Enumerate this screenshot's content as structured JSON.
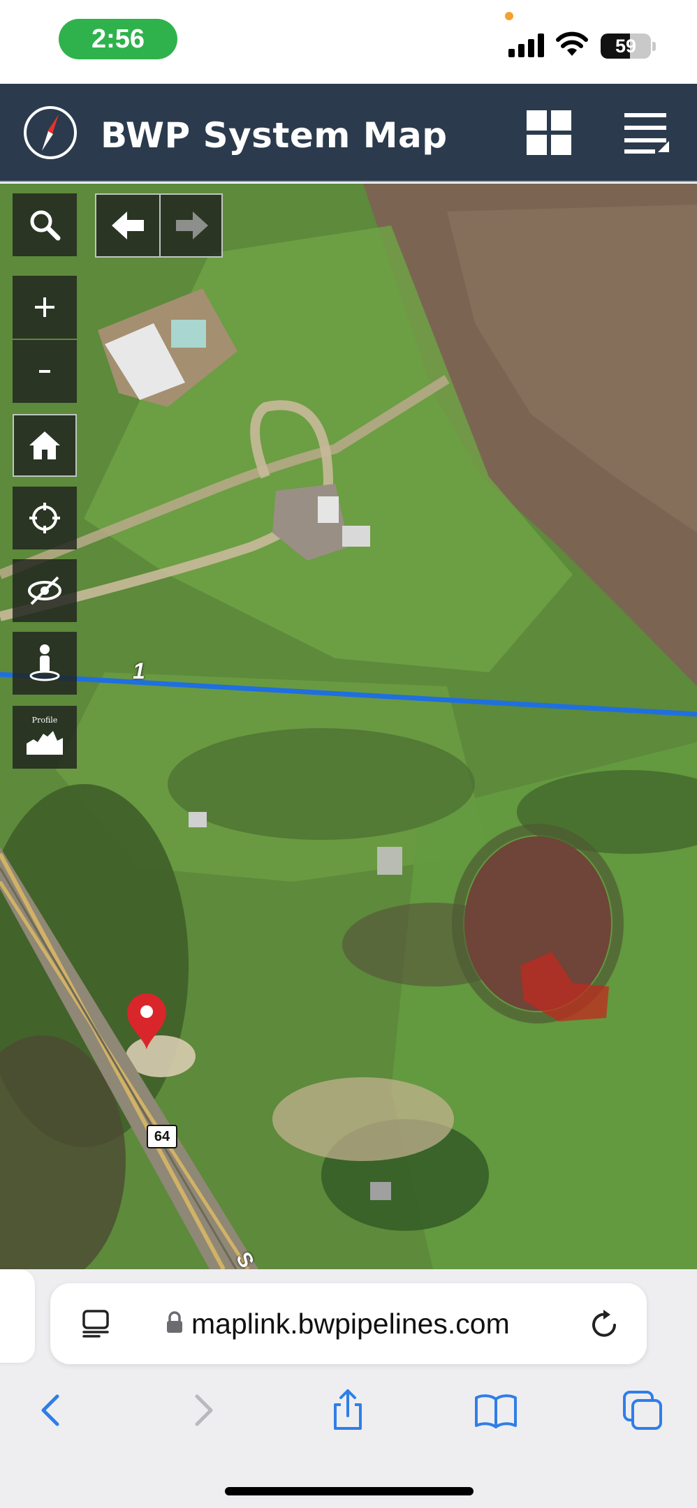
{
  "status_bar": {
    "time": "2:56",
    "battery_percent": "59",
    "battery_level": 0.59
  },
  "header": {
    "title": "BWP System Map",
    "logo_icon": "compass-icon",
    "grid_icon": "grid-icon",
    "menu_icon": "menu-icon",
    "color": "#2b3b4d"
  },
  "map": {
    "toolbar": [
      {
        "name": "search",
        "icon": "search-icon"
      },
      {
        "name": "zoom-in",
        "icon": "plus-icon"
      },
      {
        "name": "zoom-out",
        "icon": "minus-icon"
      },
      {
        "name": "home",
        "icon": "home-icon"
      },
      {
        "name": "locate",
        "icon": "crosshair-icon"
      },
      {
        "name": "clear-view",
        "icon": "eye-slash-icon"
      },
      {
        "name": "street-view",
        "icon": "person-icon"
      },
      {
        "name": "profile",
        "icon": "profile-chart-icon",
        "label": "Profile"
      }
    ],
    "nav": {
      "back_icon": "arrow-left-icon",
      "forward_icon": "arrow-right-icon"
    },
    "pipeline_label": "1",
    "pipeline_color": "#1f6fe0",
    "route_shield": "64",
    "marker_icon": "map-pin-icon",
    "road_label": "S"
  },
  "browser": {
    "url": "maplink.bwpipelines.com",
    "reader_icon": "reader-icon",
    "lock_icon": "lock-icon",
    "reload_icon": "reload-icon",
    "nav_icons": [
      "back-icon",
      "forward-icon",
      "share-icon",
      "bookmarks-icon",
      "tabs-icon"
    ],
    "accent": "#2f7ee8"
  }
}
